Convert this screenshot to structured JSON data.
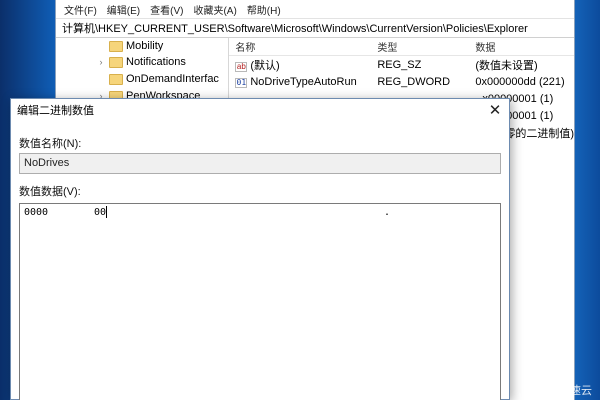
{
  "menubar": {
    "items": [
      "文件(F)",
      "编辑(E)",
      "查看(V)",
      "收藏夹(A)",
      "帮助(H)"
    ]
  },
  "address": {
    "path": "计算机\\HKEY_CURRENT_USER\\Software\\Microsoft\\Windows\\CurrentVersion\\Policies\\Explorer"
  },
  "tree": {
    "items": [
      "Mobility",
      "Notifications",
      "OnDemandInterfac",
      "PenWorkspace"
    ]
  },
  "values": {
    "headers": {
      "name": "名称",
      "type": "类型",
      "data": "数据"
    },
    "rows": [
      {
        "name": "(默认)",
        "type": "REG_SZ",
        "data": "(数值未设置)",
        "icon": "string-value-icon"
      },
      {
        "name": "NoDriveTypeAutoRun",
        "type": "REG_DWORD",
        "data": "0x000000dd (221)",
        "icon": "binary-value-icon"
      },
      {
        "name": "",
        "type": "",
        "data": "x00000001 (1)",
        "icon": ""
      },
      {
        "name": "",
        "type": "",
        "data": "x00000001 (1)",
        "icon": ""
      },
      {
        "name": "",
        "type": "",
        "data": "度为零的二进制值)",
        "icon": ""
      }
    ]
  },
  "dialog": {
    "title": "编辑二进制数值",
    "name_label": "数值名称(N):",
    "name_value": "NoDrives",
    "data_label": "数值数据(V):",
    "hex_offset": "0000",
    "hex_bytes": "00",
    "ascii": "."
  },
  "watermark": {
    "text": "亿速云"
  },
  "colors": {
    "desktop": "#1a74cc",
    "window_border": "#6d8bb0",
    "field_bg": "#f0f0f0"
  }
}
